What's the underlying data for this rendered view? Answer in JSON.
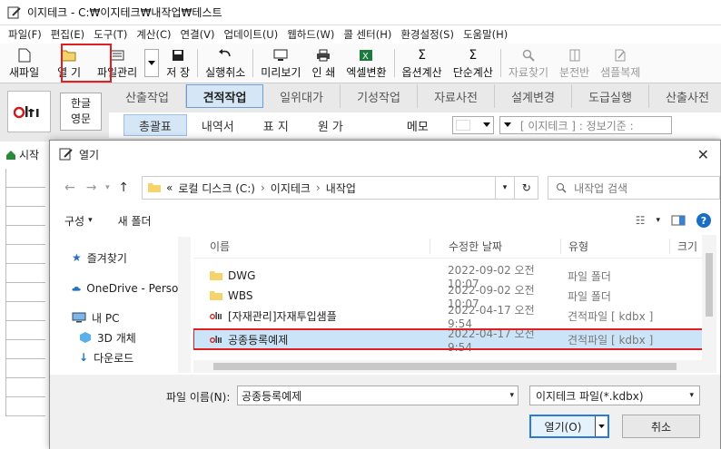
{
  "window": {
    "title": "이지테크 - C:₩이지테크₩내작업₩테스트"
  },
  "menu": [
    "파일(F)",
    "편집(E)",
    "도구(T)",
    "계산(C)",
    "연결(V)",
    "업데이트(U)",
    "웹하드(W)",
    "콜 센터(H)",
    "환경설정(S)",
    "도움말(H)"
  ],
  "toolbar": {
    "new": "새파일",
    "open": "열 기",
    "file_mgmt": "파일관리",
    "save": "저 장",
    "undo": "실행취소",
    "preview": "미리보기",
    "print": "인 쇄",
    "excel": "엑셀변환",
    "option_calc": "옵션계산",
    "simple_calc": "단순계산",
    "material_find": "자료찾기",
    "split": "분전반",
    "sample": "샘플복제"
  },
  "logo": {
    "text": "olti"
  },
  "lang": {
    "line1": "한글",
    "line2": "영문"
  },
  "main_tabs": [
    "산출작업",
    "견적작업",
    "일위대가",
    "기성작업",
    "자료사전",
    "설계변경",
    "도급실행",
    "산출사전"
  ],
  "active_main_tab": "견적작업",
  "sub_tabs": [
    "총괄표",
    "내역서",
    "표 지",
    "원 가"
  ],
  "memo_label": "메모",
  "info_dropdown": "[ 이지테크 ] : 정보기준 :",
  "bg_left": {
    "start_label": "시작"
  },
  "dialog": {
    "title": "열기",
    "path": [
      "«",
      "로컬 디스크 (C:)",
      "이지테크",
      "내작업"
    ],
    "search_placeholder": "내작업 검색",
    "organize": "구성",
    "new_folder": "새 폴더",
    "nav_items": [
      "즐겨찾기",
      "OneDrive - Person",
      "내 PC",
      "3D 개체",
      "다운로드"
    ],
    "columns": {
      "name": "이름",
      "date": "수정한 날짜",
      "type": "유형",
      "size": "크기"
    },
    "files": [
      {
        "name": "DWG",
        "date": "2022-09-02 오전 10:07",
        "type": "파일 폴더",
        "kind": "folder"
      },
      {
        "name": "WBS",
        "date": "2022-09-02 오전 10:07",
        "type": "파일 폴더",
        "kind": "folder"
      },
      {
        "name": "[자재관리]자재투입샘플",
        "date": "2022-04-17 오전 9:54",
        "type": "견적파일 [ kdbx ]",
        "kind": "kdbx"
      },
      {
        "name": "공종등록예제",
        "date": "2022-04-17 오전 9:54",
        "type": "견적파일 [ kdbx ]",
        "kind": "kdbx"
      }
    ],
    "filename_label": "파일 이름(N):",
    "filename_value": "공종등록예제",
    "filter_value": "이지테크 파일(*.kdbx)",
    "open_button": "열기(O)",
    "cancel_button": "취소"
  }
}
